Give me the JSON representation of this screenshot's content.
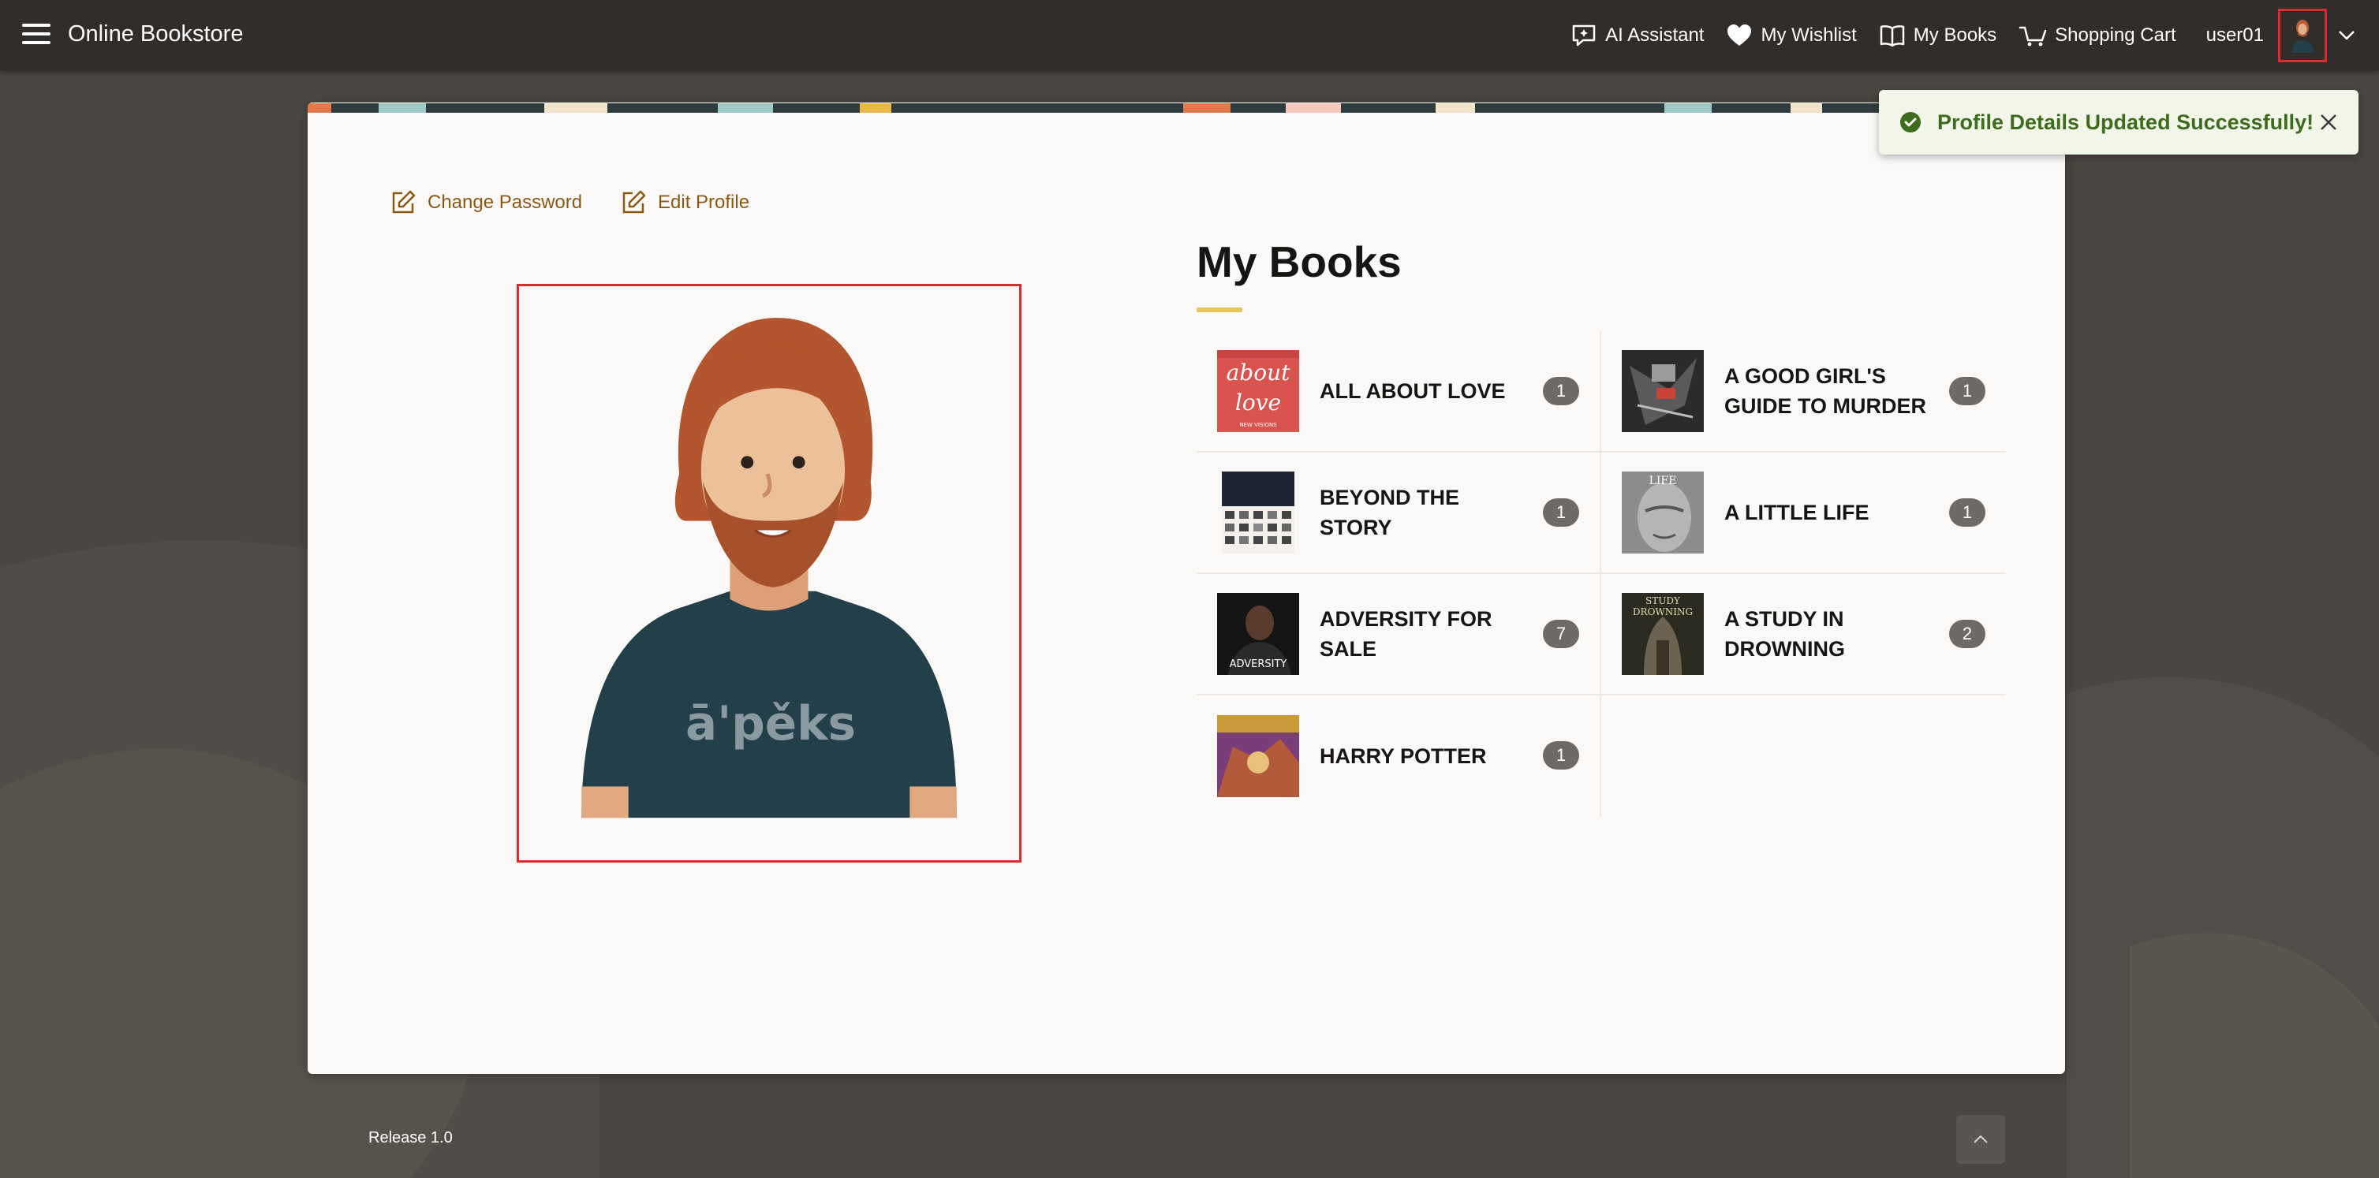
{
  "header": {
    "app_title": "Online Bookstore",
    "nav": [
      {
        "label": "AI Assistant",
        "icon": "ai-chat-icon"
      },
      {
        "label": "My Wishlist",
        "icon": "heart-icon"
      },
      {
        "label": "My Books",
        "icon": "open-book-icon"
      },
      {
        "label": "Shopping Cart",
        "icon": "cart-icon"
      }
    ],
    "user": "user01"
  },
  "profile": {
    "change_password": "Change Password",
    "edit_profile": "Edit Profile",
    "shirt_text": "ā'pěks"
  },
  "books": {
    "title": "My Books",
    "items": [
      {
        "title": "ALL ABOUT LOVE",
        "count": "1",
        "cover_text": [
          "about",
          "love",
          "NEW VISIONS"
        ]
      },
      {
        "title": "A GOOD GIRL'S GUIDE TO MURDER",
        "count": "1"
      },
      {
        "title": "BEYOND THE STORY",
        "count": "1"
      },
      {
        "title": "A LITTLE LIFE",
        "count": "1",
        "cover_text": [
          "LIFE"
        ]
      },
      {
        "title": "ADVERSITY FOR SALE",
        "count": "7",
        "cover_text": [
          "ADVERSITY"
        ]
      },
      {
        "title": "A STUDY IN DROWNING",
        "count": "2",
        "cover_text": [
          "STUDY",
          "DROWNING"
        ]
      },
      {
        "title": "HARRY POTTER",
        "count": "1"
      }
    ]
  },
  "toast": {
    "message": "Profile Details Updated Successfully!"
  },
  "footer": {
    "release": "Release 1.0"
  },
  "colors": {
    "header_bg": "#312d2a",
    "page_bg": "#4a4641",
    "card_bg": "#fbf9f8",
    "link": "#8a5a14",
    "accent_underline": "#e2c35c",
    "highlight_border": "#d32f2f",
    "toast_bg": "#f1f6e9",
    "toast_text": "#3f6b1e"
  }
}
